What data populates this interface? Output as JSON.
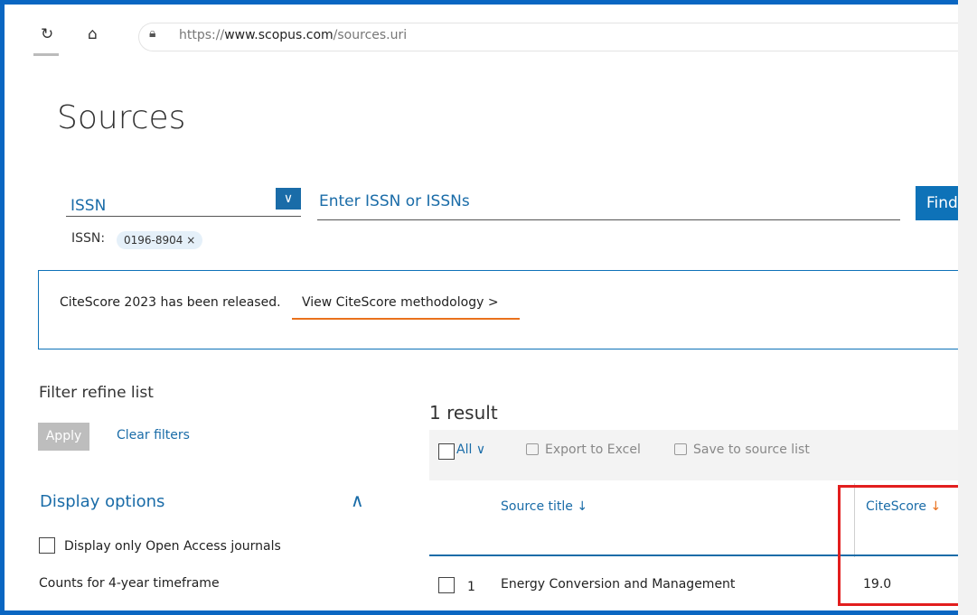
{
  "browser": {
    "url_prefix": "https://",
    "url_domain": "www.scopus.com",
    "url_path": "/sources.uri"
  },
  "page": {
    "title": "Sources"
  },
  "search": {
    "type_label": "ISSN",
    "placeholder": "Enter ISSN or ISSNs",
    "find_label": "Find",
    "active_filter_label": "ISSN:",
    "active_filter_value": "0196-8904"
  },
  "banner": {
    "text": "CiteScore 2023 has been released.",
    "link": "View CiteScore methodology"
  },
  "filters": {
    "heading": "Filter refine list",
    "apply_label": "Apply",
    "clear_label": "Clear filters",
    "display_options_label": "Display options",
    "open_access_label": "Display only Open Access journals",
    "counts_label": "Counts for 4-year timeframe"
  },
  "results": {
    "count_label": "1 result",
    "select_all_label": "All",
    "export_label": "Export to Excel",
    "save_label": "Save to source list",
    "columns": {
      "source_title": "Source title",
      "citescore": "CiteScore"
    },
    "rows": [
      {
        "index": "1",
        "title": "Energy Conversion and Management",
        "citescore": "19.0"
      }
    ]
  },
  "colors": {
    "accent": "#1a6ca8",
    "highlight": "#e21e1e",
    "orange": "#e9711c"
  }
}
